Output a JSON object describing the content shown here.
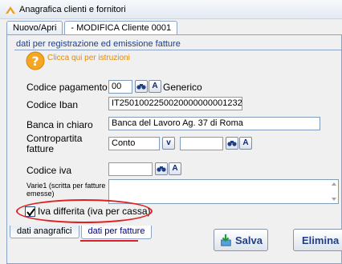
{
  "window": {
    "title": "Anagrafica clienti e fornitori"
  },
  "top_tabs": [
    {
      "label": "Nuovo/Apri"
    },
    {
      "label": " - MODIFICA Cliente 0001"
    }
  ],
  "section": {
    "title": "dati per registrazione ed emissione fatture",
    "help_text": "Clicca qui per istruzioni"
  },
  "form": {
    "codice_pagamento": {
      "label": "Codice pagamento",
      "value": "00",
      "description": "Generico"
    },
    "codice_iban": {
      "label": "Codice Iban",
      "value": "IT2501002250020000000001232"
    },
    "banca": {
      "label": "Banca in chiaro",
      "value": "Banca del Lavoro Ag. 37 di Roma"
    },
    "contropartita": {
      "label_line1": "Contropartita",
      "label_line2": "fatture",
      "value": "Conto",
      "secondary_value": ""
    },
    "codice_iva": {
      "label": "Codice iva",
      "value": ""
    },
    "varie1": {
      "label_line1": "Varie1 (scritta per fatture",
      "label_line2": "emesse)",
      "value": ""
    },
    "iva_differita": {
      "label": "Iva differita (iva per cassa)",
      "checked": true
    }
  },
  "bottom_tabs": [
    {
      "label": "dati anagrafici"
    },
    {
      "label": "dati per fatture"
    }
  ],
  "buttons": {
    "salva": "Salva",
    "elimina": "Elimina",
    "lookup_a": "A",
    "dropdown_v": "v"
  },
  "colors": {
    "annotation": "#e02020",
    "accent": "#1f3f86",
    "help": "#e68a00"
  }
}
